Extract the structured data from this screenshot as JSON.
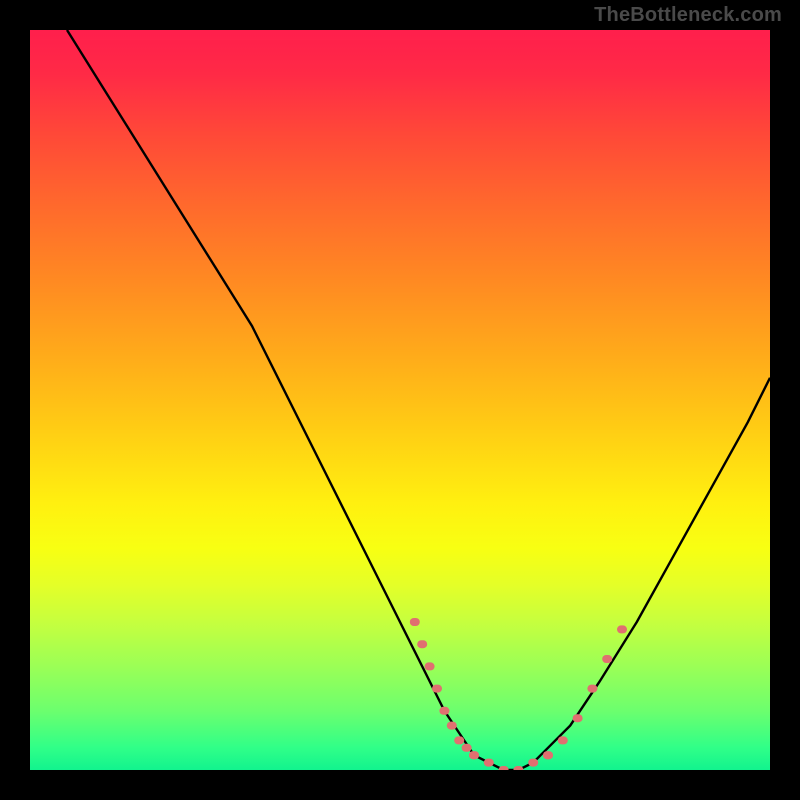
{
  "watermark": "TheBottleneck.com",
  "chart_data": {
    "type": "line",
    "title": "",
    "xlabel": "",
    "ylabel": "",
    "xlim": [
      0,
      100
    ],
    "ylim": [
      0,
      100
    ],
    "grid": false,
    "legend": false,
    "series": [
      {
        "name": "bottleneck-curve",
        "color": "#000000",
        "x": [
          5,
          10,
          15,
          20,
          25,
          30,
          35,
          40,
          45,
          50,
          53,
          56,
          58,
          60,
          62,
          64,
          66,
          68,
          70,
          73,
          77,
          82,
          87,
          92,
          97,
          100
        ],
        "values": [
          100,
          92,
          84,
          76,
          68,
          60,
          50,
          40,
          30,
          20,
          14,
          8,
          5,
          2,
          1,
          0,
          0,
          1,
          3,
          6,
          12,
          20,
          29,
          38,
          47,
          53
        ]
      }
    ],
    "annotations": [
      {
        "name": "dotted-left-arm",
        "type": "dotted-line",
        "color": "#e07070",
        "x": [
          52,
          53,
          54,
          55,
          56,
          57,
          58,
          59,
          60
        ],
        "values": [
          20,
          17,
          14,
          11,
          8,
          6,
          4,
          3,
          2
        ]
      },
      {
        "name": "dotted-bottom",
        "type": "dotted-line",
        "color": "#e07070",
        "x": [
          60,
          62,
          64,
          66,
          68,
          70
        ],
        "values": [
          2,
          1,
          0,
          0,
          1,
          2
        ]
      },
      {
        "name": "dotted-right-arm",
        "type": "dotted-line",
        "color": "#e07070",
        "x": [
          70,
          72,
          74,
          76,
          78,
          80
        ],
        "values": [
          2,
          4,
          7,
          11,
          15,
          19
        ]
      }
    ],
    "gradient_stops": [
      {
        "pos": 0,
        "color": "#ff1f4c"
      },
      {
        "pos": 50,
        "color": "#ffd014"
      },
      {
        "pos": 100,
        "color": "#12f38e"
      }
    ]
  }
}
